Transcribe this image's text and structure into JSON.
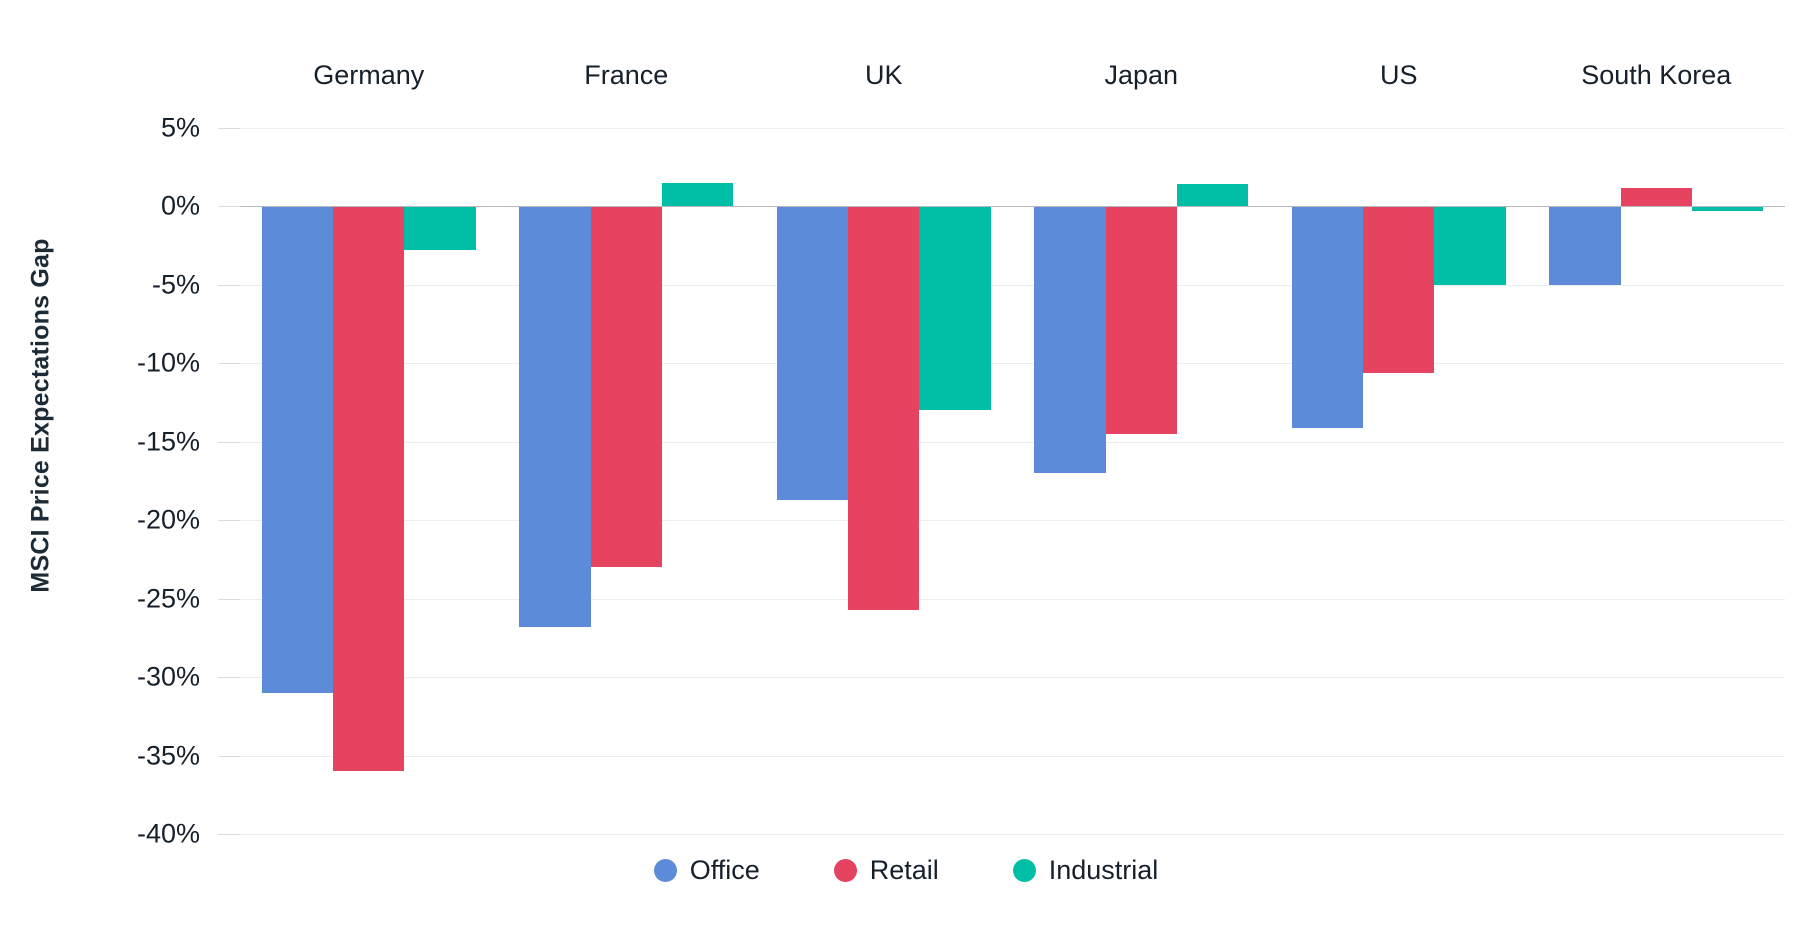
{
  "chart_data": {
    "type": "bar",
    "title": "",
    "subtitle": "",
    "xlabel": "",
    "ylabel": "MSCI Price Expectations Gap",
    "categories": [
      "Germany",
      "France",
      "UK",
      "Japan",
      "US",
      "South Korea"
    ],
    "series": [
      {
        "name": "Office",
        "color": "#5b8bd9",
        "values": [
          -31.0,
          -26.8,
          -18.7,
          -17.0,
          -14.1,
          -5.0
        ]
      },
      {
        "name": "Retail",
        "color": "#e54360",
        "values": [
          -36.0,
          -23.0,
          -25.7,
          -14.5,
          -10.6,
          1.2
        ]
      },
      {
        "name": "Industrial",
        "color": "#00bfa6",
        "values": [
          -2.8,
          1.5,
          -13.0,
          1.4,
          -5.0,
          -0.3
        ]
      }
    ],
    "ylim": [
      -40,
      5
    ],
    "ytick_values": [
      5,
      0,
      -5,
      -10,
      -15,
      -20,
      -25,
      -30,
      -35,
      -40
    ],
    "ytick_labels": [
      "5%",
      "0%",
      "-5%",
      "-10%",
      "-15%",
      "-20%",
      "-25%",
      "-30%",
      "-35%",
      "-40%"
    ],
    "unit": "%",
    "grid": true,
    "grid_color": "#ededef",
    "zero_line_color": "#b9b9bd",
    "legend_position": "bottom",
    "category_label_position": "top",
    "background_color": "#ffffff",
    "text_color": "#16202b"
  }
}
